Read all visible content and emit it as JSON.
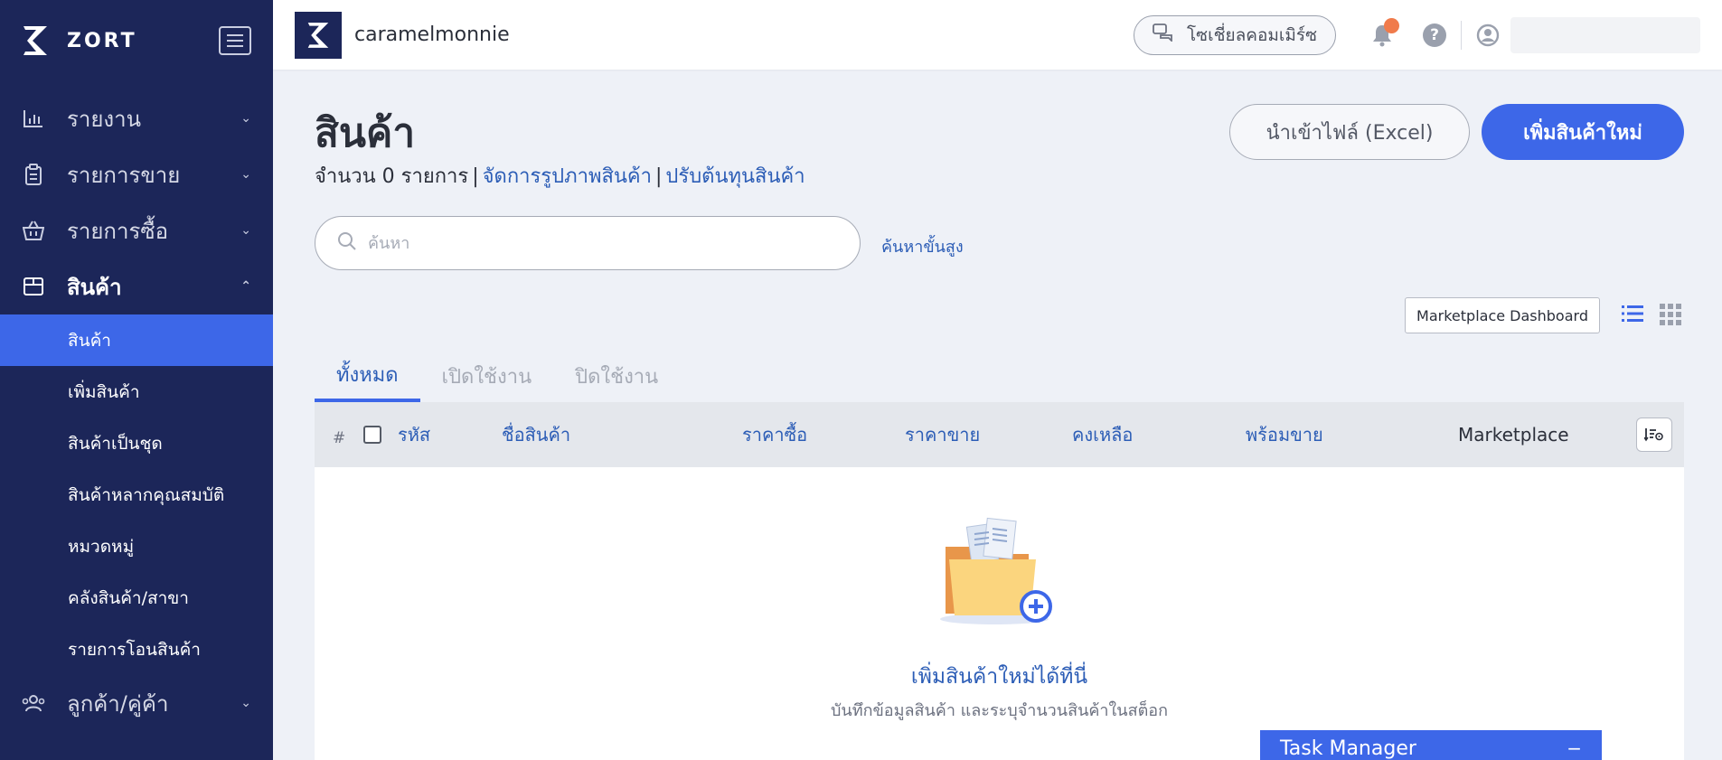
{
  "brand": {
    "name": "ZORT"
  },
  "sidebar": {
    "items": [
      {
        "label": "รายงาน",
        "icon": "bar-chart-icon"
      },
      {
        "label": "รายการขาย",
        "icon": "clipboard-icon"
      },
      {
        "label": "รายการซื้อ",
        "icon": "basket-icon"
      },
      {
        "label": "สินค้า",
        "icon": "box-icon",
        "open": true
      }
    ],
    "subitems": [
      {
        "label": "สินค้า",
        "active": true
      },
      {
        "label": "เพิ่มสินค้า"
      },
      {
        "label": "สินค้าเป็นชุด"
      },
      {
        "label": "สินค้าหลากคุณสมบัติ"
      },
      {
        "label": "หมวดหมู่"
      },
      {
        "label": "คลังสินค้า/สาขา"
      },
      {
        "label": "รายการโอนสินค้า"
      }
    ],
    "after": [
      {
        "label": "ลูกค้า/คู่ค้า",
        "icon": "users-icon"
      }
    ]
  },
  "topbar": {
    "shop_name": "caramelmonnie",
    "social_commerce": "โซเชี่ยลคอมเมิร์ซ"
  },
  "page": {
    "title": "สินค้า",
    "count_text": "จำนวน 0 รายการ",
    "link_manage_images": "จัดการรูปภาพสินค้า",
    "link_adjust_cost": "ปรับต้นทุนสินค้า",
    "import_button": "นำเข้าไฟล์ (Excel)",
    "add_button": "เพิ่มสินค้าใหม่",
    "search_placeholder": "ค้นหา",
    "advanced_search": "ค้นหาขั้นสูง",
    "marketplace_dashboard": "Marketplace Dashboard"
  },
  "tabs": [
    {
      "label": "ทั้งหมด",
      "active": true
    },
    {
      "label": "เปิดใช้งาน"
    },
    {
      "label": "ปิดใช้งาน"
    }
  ],
  "table": {
    "headers": {
      "num": "#",
      "code": "รหัส",
      "name": "ชื่อสินค้า",
      "buy_price": "ราคาซื้อ",
      "sell_price": "ราคาขาย",
      "stock": "คงเหลือ",
      "ready": "พร้อมขาย",
      "marketplace": "Marketplace"
    },
    "empty_title": "เพิ่มสินค้าใหม่ได้ที่นี่",
    "empty_desc": "บันทึกข้อมูลสินค้า และระบุจำนวนสินค้าในสต็อก"
  },
  "task_manager": {
    "label": "Task Manager",
    "toggle": "−"
  },
  "colors": {
    "sidebar": "#1c2659",
    "accent": "#3d67e8",
    "link": "#2c5db6",
    "notify": "#f07b4b"
  }
}
